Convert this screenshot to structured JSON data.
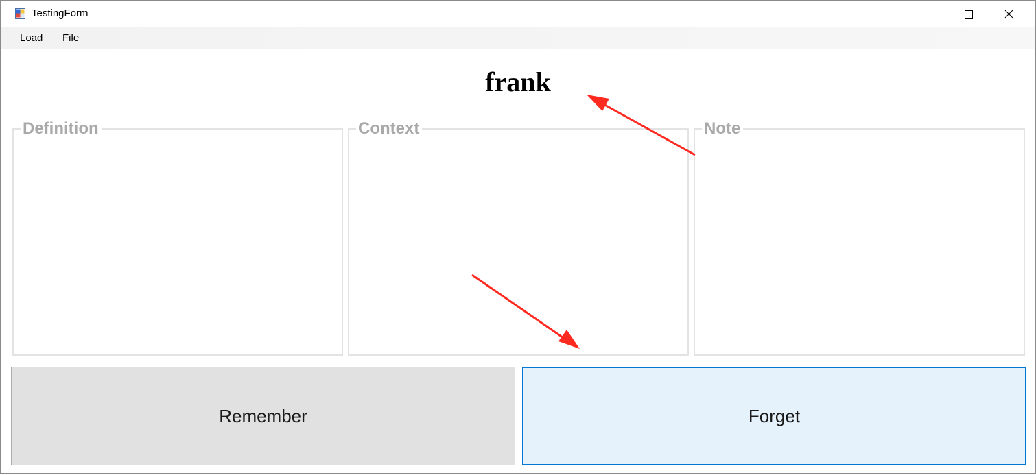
{
  "window": {
    "title": "TestingForm",
    "icons": {
      "app": "app-form-icon",
      "minimize": "minimize-icon",
      "maximize": "maximize-icon",
      "close": "close-icon"
    }
  },
  "menu": {
    "items": [
      {
        "label": "Load"
      },
      {
        "label": "File"
      }
    ]
  },
  "main": {
    "word": "frank",
    "groups": [
      {
        "label": "Definition"
      },
      {
        "label": "Context"
      },
      {
        "label": "Note"
      }
    ],
    "buttons": {
      "remember": "Remember",
      "forget": "Forget"
    }
  },
  "colors": {
    "annotation_arrow": "#ff2a1f",
    "focused_button_border": "#0078d7",
    "focused_button_fill": "#e5f1fb",
    "button_fill": "#e1e1e1",
    "group_label": "#a9a9a9"
  }
}
